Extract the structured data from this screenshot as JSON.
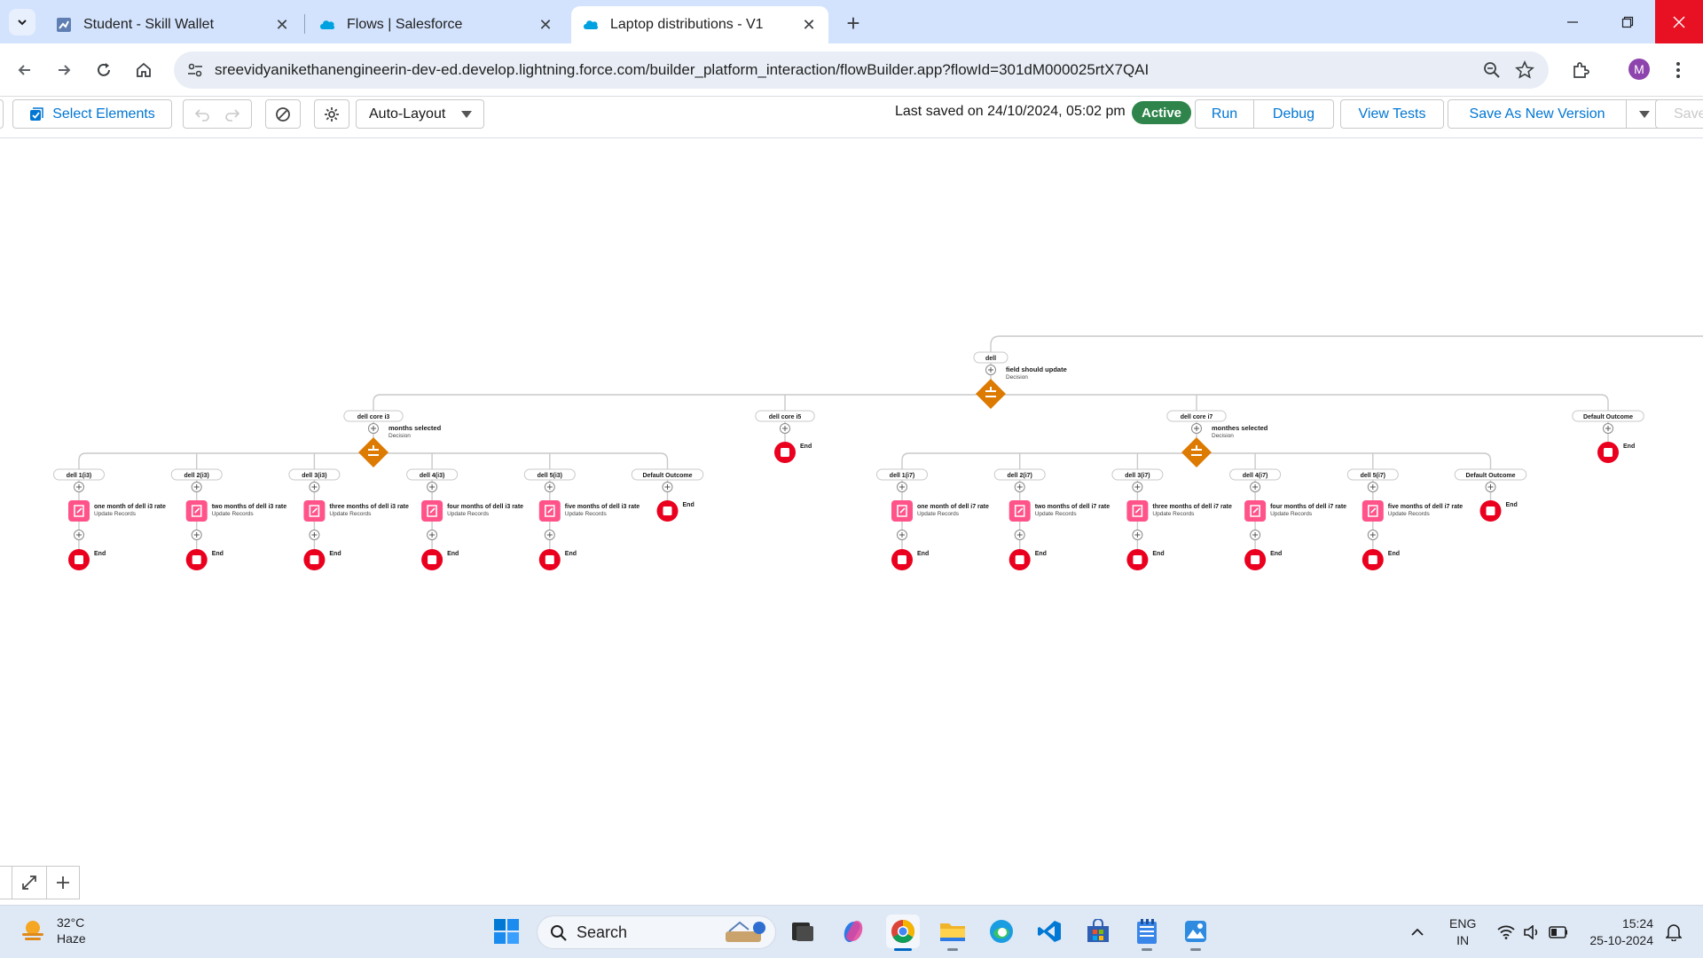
{
  "browser": {
    "tabs": [
      {
        "label": "Student - Skill Wallet",
        "active": false
      },
      {
        "label": "Flows | Salesforce",
        "active": false
      },
      {
        "label": "Laptop distributions - V1",
        "active": true
      }
    ],
    "url": "sreevidyanikethanengineerin-dev-ed.develop.lightning.force.com/builder_platform_interaction/flowBuilder.app?flowId=301dM000025rtX7QAI",
    "profile_initial": "M"
  },
  "toolbar": {
    "select_elements": "Select Elements",
    "layout_mode": "Auto-Layout",
    "last_saved": "Last saved on 24/10/2024, 05:02 pm",
    "status": "Active",
    "run": "Run",
    "debug": "Debug",
    "view_tests": "View Tests",
    "save_as_new_version": "Save As New Version",
    "save": "Save"
  },
  "flow": {
    "root_label": "dell",
    "root_decision": {
      "title": "field should update",
      "subtitle": "Decision"
    },
    "branches": [
      {
        "label": "dell core i3",
        "decision": {
          "title": "months selected",
          "subtitle": "Decision"
        },
        "outcomes": [
          {
            "label": "dell 1(i3)",
            "record": "one month of dell i3 rate",
            "type": "Update Records",
            "end": "End"
          },
          {
            "label": "dell 2(i3)",
            "record": "two months of dell i3 rate",
            "type": "Update Records",
            "end": "End"
          },
          {
            "label": "dell 3(i3)",
            "record": "three months of dell i3 rate",
            "type": "Update Records",
            "end": "End"
          },
          {
            "label": "dell 4(i3)",
            "record": "four months of dell i3 rate",
            "type": "Update Records",
            "end": "End"
          },
          {
            "label": "dell 5(i3)",
            "record": "five months of dell i3 rate",
            "type": "Update Records",
            "end": "End"
          },
          {
            "label": "Default Outcome",
            "record": "",
            "type": "",
            "end": "End"
          }
        ]
      },
      {
        "label": "dell core i5",
        "decision": null,
        "outcomes": [],
        "end": "End"
      },
      {
        "label": "dell core i7",
        "decision": {
          "title": "monthes selected",
          "subtitle": "Decision"
        },
        "outcomes": [
          {
            "label": "dell 1(i7)",
            "record": "one month of dell i7 rate",
            "type": "Update Records",
            "end": "End"
          },
          {
            "label": "dell 2(i7)",
            "record": "two months of dell i7 rate",
            "type": "Update Records",
            "end": "End"
          },
          {
            "label": "dell 3(i7)",
            "record": "three months of dell i7 rate",
            "type": "Update Records",
            "end": "End"
          },
          {
            "label": "dell 4(i7)",
            "record": "four months of dell i7 rate",
            "type": "Update Records",
            "end": "End"
          },
          {
            "label": "dell 5(i7)",
            "record": "five months of dell i7 rate",
            "type": "Update Records",
            "end": "End"
          },
          {
            "label": "Default Outcome",
            "record": "",
            "type": "",
            "end": "End"
          }
        ]
      },
      {
        "label": "Default Outcome",
        "decision": null,
        "outcomes": [],
        "end": "End"
      }
    ]
  },
  "taskbar": {
    "weather": {
      "temp": "32°C",
      "condition": "Haze"
    },
    "search_label": "Search",
    "lang_top": "ENG",
    "lang_bottom": "IN",
    "time": "15:24",
    "date": "25-10-2024"
  },
  "colors": {
    "decision": "#dd7a01",
    "update_records": "#ff538a",
    "end": "#ea001e",
    "active_badge": "#2e844a",
    "salesforce_blue": "#0176d3"
  }
}
